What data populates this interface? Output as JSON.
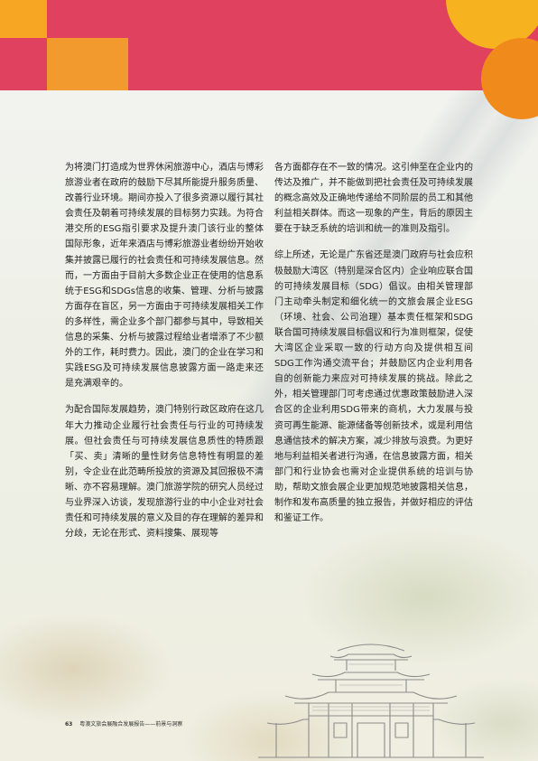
{
  "columns": {
    "left": [
      "为将澳门打造成为世界休闲旅游中心，酒店与博彩旅游业者在政府的鼓励下尽其所能提升服务质量、改善行业环境。期间亦投入了很多资源以履行其社会责任及朝着可持续发展的目标努力实践。为符合港交所的ESG指引要求及提升澳门该行业的整体国际形象，近年来酒店与博彩旅游业者纷纷开始收集并披露已履行的社会责任和可持续发展信息。然而，一方面由于目前大多数企业正在使用的信息系统于ESG和SDGs信息的收集、管理、分析与披露方面存在盲区，另一方面由于可持续发展相关工作的多样性，需企业多个部门都参与其中，导致相关信息的采集、分析与披露过程给业者增添了不少额外的工作，耗时费力。因此，澳门的企业在学习和实践ESG及可持续发展信息披露方面一路走来还是充满艰辛的。",
      "为配合国际发展趋势，澳门特别行政区政府在这几年大力推动企业履行社会责任与行业的可持续发展。但社会责任与可持续发展信息质性的特质跟「买、卖」清晰的量性财务信息特性有明显的差别，令企业在此范畴所投放的资源及其回报极不清晰、亦不容易理解。澳门旅游学院的研究人员经过与业界深入访谈，发现旅游行业的中小企业对社会责任和可持续发展的意义及目的存在理解的差异和分歧，无论在形式、资料搜集、展现等"
    ],
    "right": [
      "各方面都存在不一致的情况。这引伸至在企业内的传达及推广，并不能做到把社会责任及可持续发展的概念高效及正确地传递给不同阶层的员工和其他利益相关群体。而这一现象的产生，背后的原因主要在于缺乏系统的培训和统一的准则及指引。",
      "综上所述，无论是广东省还是澳门政府与社会应积极鼓励大湾区（特别是深合区内）企业响应联合国的可持续发展目标（SDG）倡议。由相关管理部门主动牵头制定和细化统一的文旅会展企业ESG（环境、社会、公司治理）基本责任框架和SDG联合国可持续发展目标倡议和行为准则框架，促使大湾区企业采取一致的行动方向及提供相互间SDG工作沟通交流平台；并鼓励区内企业利用各自的创新能力来应对可持续发展的挑战。除此之外，相关管理部门可考虑通过优惠政策鼓励进入深合区的企业利用SDG带来的商机，大力发展与投资可再生能源、能源储备等创新技术，或是利用信息通信技术的解决方案，减少排放与浪费。为更好地与利益相关者进行沟通，在信息披露方面，相关部门和行业协会也需对企业提供系统的培训与协助，帮助文旅会展企业更加规范地披露相关信息，制作和发布高质量的独立报告，并做好相应的评估和鉴证工作。"
    ]
  },
  "footer": {
    "page_number": "63",
    "title": "粤澳文旅会展融合发展报告——前景与洞察"
  },
  "colors": {
    "band": "#e0415e",
    "accent_orange": "#f39a2e",
    "accent_yellow": "#f6b31f"
  }
}
